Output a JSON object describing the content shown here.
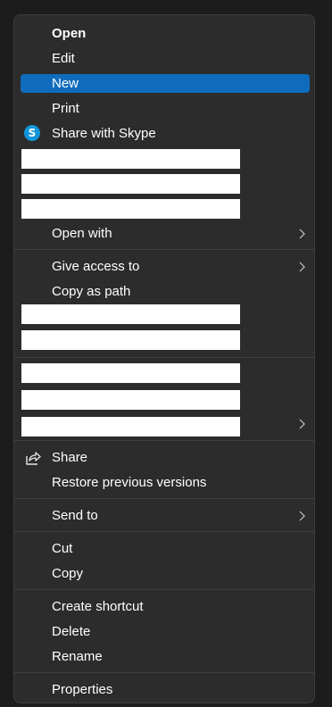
{
  "menu": {
    "items": {
      "open": "Open",
      "edit": "Edit",
      "new": "New",
      "print": "Print",
      "share_skype": "Share with Skype",
      "open_with": "Open with",
      "give_access": "Give access to",
      "copy_path": "Copy as path",
      "share": "Share",
      "restore": "Restore previous versions",
      "send_to": "Send to",
      "cut": "Cut",
      "copy": "Copy",
      "create_shortcut": "Create shortcut",
      "delete": "Delete",
      "rename": "Rename",
      "properties": "Properties"
    },
    "icons": {
      "skype": "skype-icon",
      "share": "share-icon",
      "submenu": "chevron-right-icon"
    },
    "skype_glyph": "S",
    "colors": {
      "background": "#2c2c2c",
      "selected": "#0f6cbd",
      "text": "#ffffff",
      "separator": "#3f3f3f",
      "skype": "#1296d9"
    }
  }
}
